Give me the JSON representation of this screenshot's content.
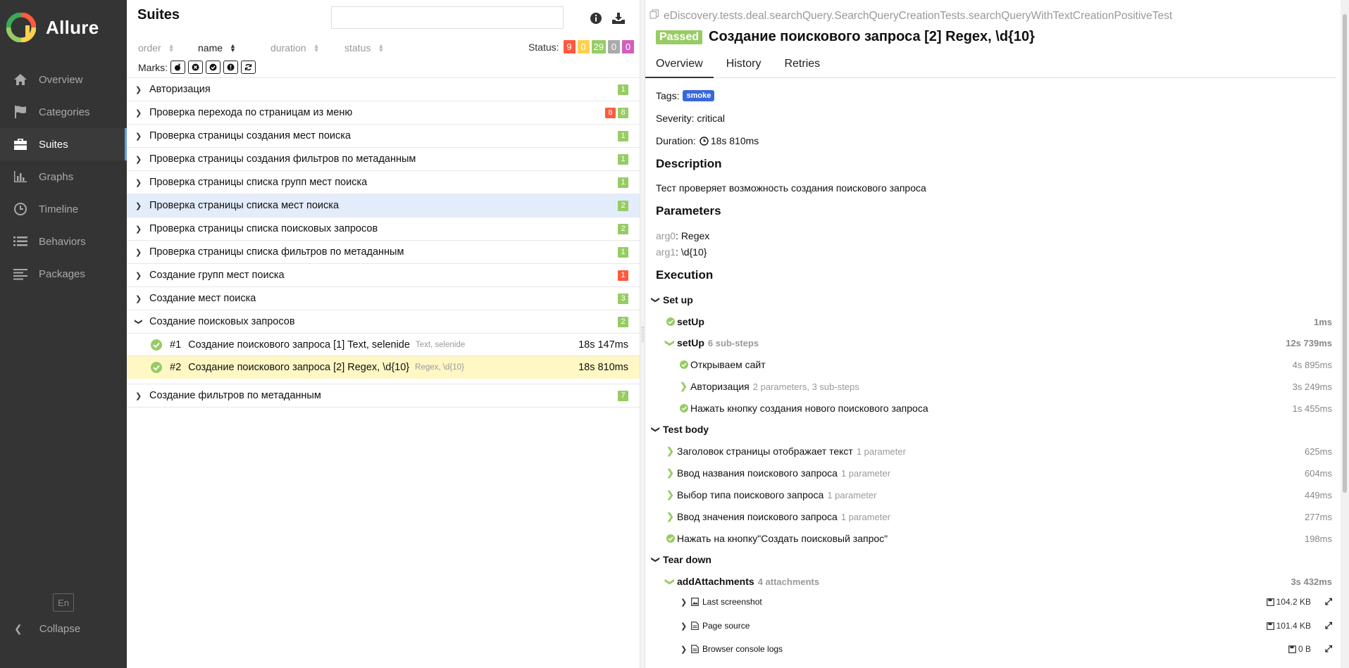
{
  "brand": {
    "name": "Allure"
  },
  "sidebar": {
    "items": [
      {
        "label": "Overview",
        "icon": "home-icon"
      },
      {
        "label": "Categories",
        "icon": "flag-icon"
      },
      {
        "label": "Suites",
        "icon": "briefcase-icon"
      },
      {
        "label": "Graphs",
        "icon": "bar-chart-icon"
      },
      {
        "label": "Timeline",
        "icon": "clock-icon"
      },
      {
        "label": "Behaviors",
        "icon": "list-icon"
      },
      {
        "label": "Packages",
        "icon": "align-left-icon"
      }
    ],
    "active": "Suites",
    "language": "En",
    "collapse": "Collapse"
  },
  "suites": {
    "title": "Suites",
    "search_value": "",
    "sort": {
      "order": "order",
      "name": "name",
      "duration": "duration",
      "status": "status"
    },
    "status_label": "Status:",
    "status_counts": {
      "failed": "9",
      "broken": "0",
      "passed": "29",
      "skipped": "0",
      "unknown": "0"
    },
    "marks_label": "Marks:",
    "groups": [
      {
        "name": "Авторизация",
        "badges": [
          {
            "type": "passed",
            "value": "1"
          }
        ]
      },
      {
        "name": "Проверка перехода по страницам из меню",
        "badges": [
          {
            "type": "failed",
            "value": "8"
          },
          {
            "type": "passed",
            "value": "8"
          }
        ]
      },
      {
        "name": "Проверка страницы создания мест поиска",
        "badges": [
          {
            "type": "passed",
            "value": "1"
          }
        ]
      },
      {
        "name": "Проверка страницы создания фильтров по метаданным",
        "badges": [
          {
            "type": "passed",
            "value": "1"
          }
        ]
      },
      {
        "name": "Проверка страницы списка групп мест поиска",
        "badges": [
          {
            "type": "passed",
            "value": "1"
          }
        ]
      },
      {
        "name": "Проверка страницы списка мест поиска",
        "badges": [
          {
            "type": "passed",
            "value": "2"
          }
        ]
      },
      {
        "name": "Проверка страницы списка поисковых запросов",
        "badges": [
          {
            "type": "passed",
            "value": "2"
          }
        ]
      },
      {
        "name": "Проверка страницы списка фильтров по метаданным",
        "badges": [
          {
            "type": "passed",
            "value": "1"
          }
        ]
      },
      {
        "name": "Создание групп мест поиска",
        "badges": [
          {
            "type": "failed",
            "value": "1"
          }
        ]
      },
      {
        "name": "Создание мест поиска",
        "badges": [
          {
            "type": "passed",
            "value": "3"
          }
        ]
      },
      {
        "name": "Создание поисковых запросов",
        "badges": [
          {
            "type": "passed",
            "value": "2"
          }
        ]
      }
    ],
    "leaves": [
      {
        "num": "#1",
        "name": "Создание поискового запроса [1] Text, selenide",
        "params": "Text, selenide",
        "duration": "18s 147ms"
      },
      {
        "num": "#2",
        "name": "Создание поискового запроса [2] Regex, \\d{10}",
        "params": "Regex, \\d{10}",
        "duration": "18s 810ms"
      }
    ],
    "last_group": {
      "name": "Создание фильтров по метаданным",
      "badge": "7"
    }
  },
  "detail": {
    "fullname": "eDiscovery.tests.deal.searchQuery.SearchQueryCreationTests.searchQueryWithTextCreationPositiveTest",
    "status": "Passed",
    "title": "Создание поискового запроса [2] Regex, \\d{10}",
    "tabs": [
      "Overview",
      "History",
      "Retries"
    ],
    "tags_label": "Tags:",
    "tag": "smoke",
    "severity": "Severity: critical",
    "duration_label": "Duration:",
    "duration": "18s 810ms",
    "description_h": "Description",
    "description": "Тест проверяет возможность создания поискового запроса",
    "parameters_h": "Parameters",
    "params": [
      {
        "name": "arg0",
        "value": "Regex"
      },
      {
        "name": "arg1",
        "value": "\\d{10}"
      }
    ],
    "execution_h": "Execution",
    "setup_label": "Set up",
    "setup": [
      {
        "name": "setUp",
        "meta": "",
        "duration": "1ms"
      },
      {
        "name": "setUp",
        "meta": "6 sub-steps",
        "duration": "12s 739ms"
      },
      {
        "name": "Открываем сайт",
        "meta": "",
        "duration": "4s 895ms"
      },
      {
        "name": "Авторизация",
        "meta": "2 parameters, 3 sub-steps",
        "duration": "3s 249ms"
      },
      {
        "name": "Нажать кнопку создания нового поискового запроса",
        "meta": "",
        "duration": "1s 455ms"
      }
    ],
    "body_label": "Test body",
    "body": [
      {
        "name": "Заголовок страницы отображает текст",
        "meta": "1 parameter",
        "duration": "625ms"
      },
      {
        "name": "Ввод названия поискового запроса",
        "meta": "1 parameter",
        "duration": "604ms"
      },
      {
        "name": "Выбор типа поискового запроса",
        "meta": "1 parameter",
        "duration": "449ms"
      },
      {
        "name": "Ввод значения поискового запроса",
        "meta": "1 parameter",
        "duration": "277ms"
      },
      {
        "name": "Нажать на кнопку\"Создать поисковый запрос\"",
        "meta": "",
        "duration": "198ms"
      }
    ],
    "teardown_label": "Tear down",
    "teardown": {
      "name": "addAttachments",
      "meta": "4 attachments",
      "duration": "3s 432ms"
    },
    "attachments": [
      {
        "name": "Last screenshot",
        "size": "104.2 KB"
      },
      {
        "name": "Page source",
        "size": "101.4 KB"
      },
      {
        "name": "Browser console logs",
        "size": "0 B"
      }
    ]
  },
  "colors": {
    "passed": "#97cc64",
    "failed": "#fd5a3e",
    "broken": "#ffd050",
    "skipped": "#aaaaaa",
    "unknown": "#d35ebe",
    "tag": "#3967da",
    "sidebar": "#343434"
  }
}
